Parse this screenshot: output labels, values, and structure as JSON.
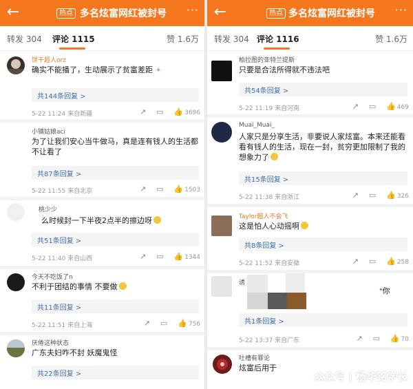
{
  "colors": {
    "brand": "#f4761d",
    "link": "#3d6ea8",
    "username": "#e07a22"
  },
  "left": {
    "header": {
      "back": "←",
      "hot_badge": "热点",
      "title": "多名炫富网红被封号",
      "more": "···"
    },
    "tabs": {
      "repost": "转发 304",
      "comments": "评论 1115",
      "likes": "赞 1.6万"
    },
    "comments": [
      {
        "user": "饼干超人orz",
        "text": "确实不能播了，生动展示了贫富差距",
        "replies": "共144条回复 >",
        "meta": "5-22 11:24 来自新疆",
        "likes": "3696"
      },
      {
        "user": "小镇姑娘aci",
        "text": "为了让我们安心当牛做马，真是连有钱人的生活都不让看了",
        "replies": "共87条回复 >",
        "meta": "5-22 11:55 来自北京",
        "likes": "1503"
      },
      {
        "user": "桃少少",
        "text": "么时候封一下半夜2点半的擦边呀",
        "replies": "共51条回复 >",
        "meta": "5-22 11:40 来自山西",
        "likes": "1344"
      },
      {
        "user": "今天不吃饭了n",
        "text": "不利于团结的事情 不要做",
        "replies": "共11条回复 >",
        "meta": "5-22 11:51 来自上海",
        "likes": "756"
      },
      {
        "user": "厌倦这种状态",
        "text": "广东夫妇咋不封 妖魔鬼怪",
        "replies": "共22条回复 >",
        "meta": "",
        "likes": ""
      }
    ]
  },
  "right": {
    "header": {
      "back": "←",
      "hot_badge": "热点",
      "title": "多名炫富网红被封号",
      "more": "···"
    },
    "tabs": {
      "repost": "转发 304",
      "comments": "评论 1116",
      "likes": "赞 1.6万"
    },
    "comments": [
      {
        "user": "柏拉图的亚特兰提斯",
        "text": "只要是合法所得就不违法吧",
        "replies": "共54条回复 >",
        "meta": "5-22 11:19 来自河南",
        "likes": "469"
      },
      {
        "user": "Muai_Muai_",
        "text": "人家只是分享生活，非要说人家炫富。本来还能看看有钱人的生活，现在一封，贫穷更加限制了我的想象力了",
        "replies": "共15条回复 >",
        "meta": "5-22 11:38 来自浙江",
        "likes": "326"
      },
      {
        "user": "Taylor超人不会飞",
        "text": "这是怕人心动摇啊",
        "replies": "共8条回复 >",
        "meta": "5-22 11:52 来自安徽",
        "likes": "258"
      },
      {
        "user": "诱",
        "text": "你",
        "replies": "共1条回复 >",
        "meta": "5-22 13:37 来自广东",
        "likes": "70"
      },
      {
        "user": "吐槽有罪论",
        "text": "炫富后用于",
        "replies": "",
        "meta": "",
        "likes": ""
      }
    ],
    "watermark": "众众号 | 杨华铭学长"
  }
}
